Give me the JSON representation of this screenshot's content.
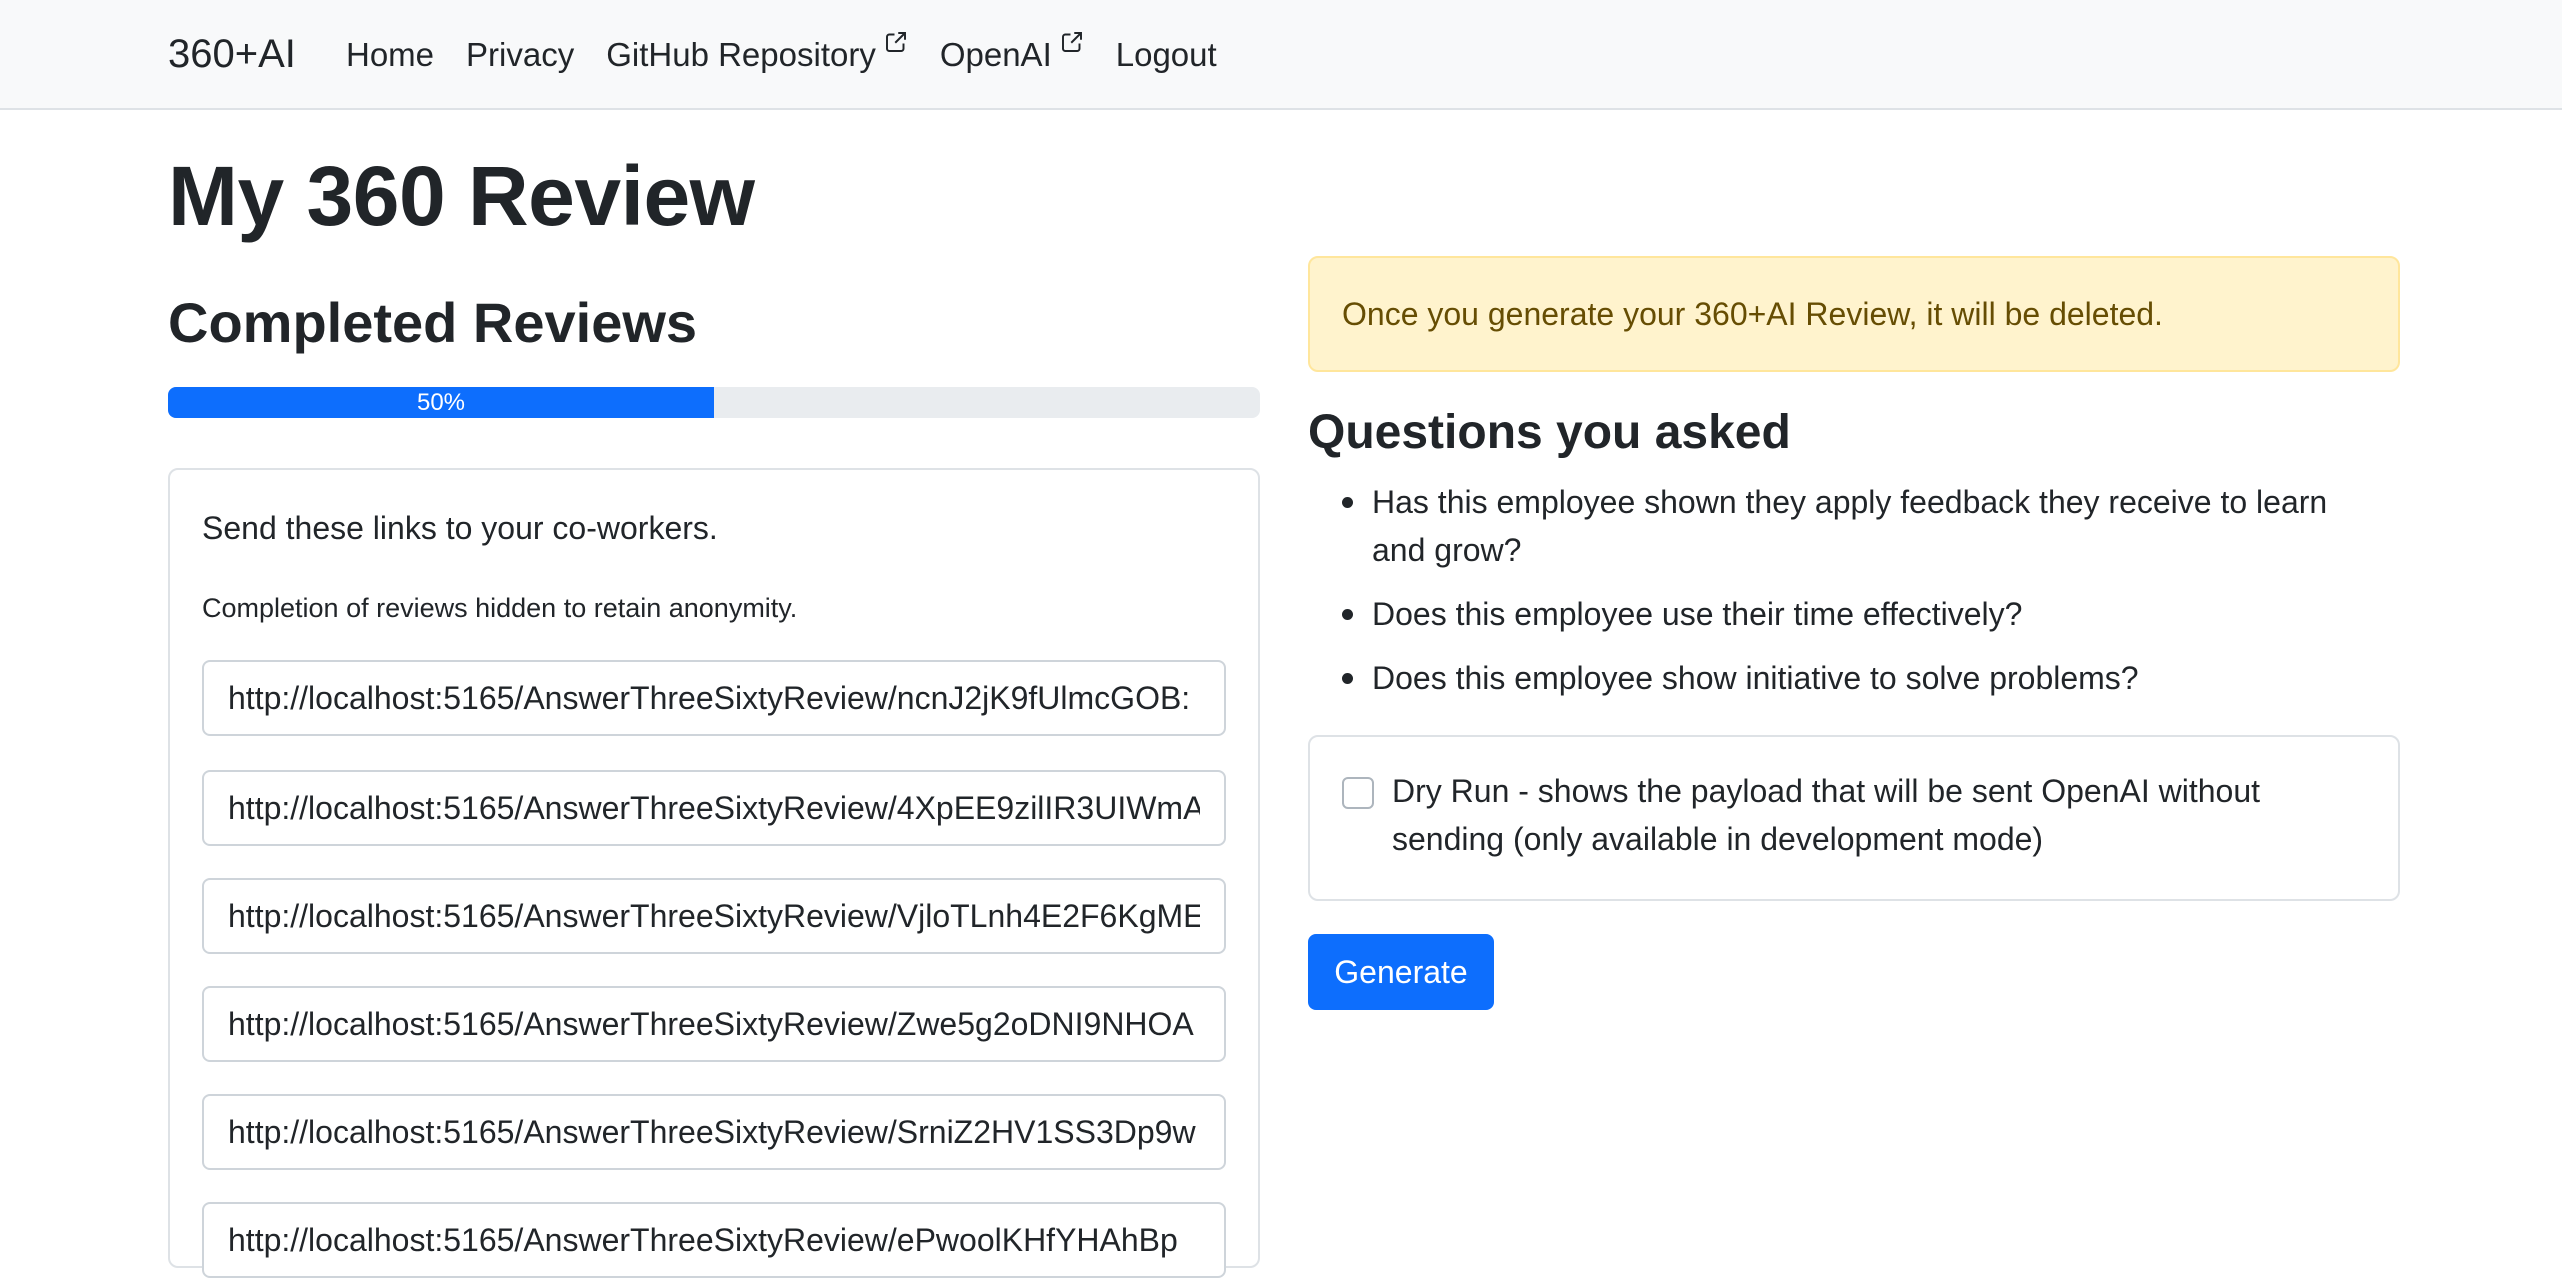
{
  "navbar": {
    "brand": "360+AI",
    "links": [
      {
        "label": "Home",
        "external": false
      },
      {
        "label": "Privacy",
        "external": false
      },
      {
        "label": "GitHub Repository",
        "external": true
      },
      {
        "label": "OpenAI",
        "external": true
      },
      {
        "label": "Logout",
        "external": false
      }
    ]
  },
  "page": {
    "title": "My 360 Review"
  },
  "completed": {
    "title": "Completed Reviews",
    "progress_percent": 50,
    "progress_label": "50%",
    "intro": "Send these links to your co-workers.",
    "note": "Completion of reviews hidden to retain anonymity.",
    "links": [
      "http://localhost:5165/AnswerThreeSixtyReview/ncnJ2jK9fUlmcGOB:",
      "http://localhost:5165/AnswerThreeSixtyReview/4XpEE9zilIR3UIWmA",
      "http://localhost:5165/AnswerThreeSixtyReview/VjloTLnh4E2F6KgME",
      "http://localhost:5165/AnswerThreeSixtyReview/Zwe5g2oDNI9NHOA",
      "http://localhost:5165/AnswerThreeSixtyReview/SrniZ2HV1SS3Dp9w",
      "http://localhost:5165/AnswerThreeSixtyReview/ePwoolKHfYHAhBp"
    ]
  },
  "alert": {
    "text": "Once you generate your 360+AI Review, it will be deleted."
  },
  "questions": {
    "title": "Questions you asked",
    "items": [
      "Has this employee shown they apply feedback they receive to learn and grow?",
      "Does this employee use their time effectively?",
      "Does this employee show initiative to solve problems?"
    ]
  },
  "dry_run": {
    "label": "Dry Run - shows the payload that will be sent OpenAI without sending (only available in development mode)",
    "checked": false
  },
  "actions": {
    "generate_label": "Generate"
  },
  "colors": {
    "primary": "#0d6efd",
    "alert_bg": "#fff3cd",
    "alert_text": "#664d03",
    "navbar_bg": "#f8f9fa"
  }
}
